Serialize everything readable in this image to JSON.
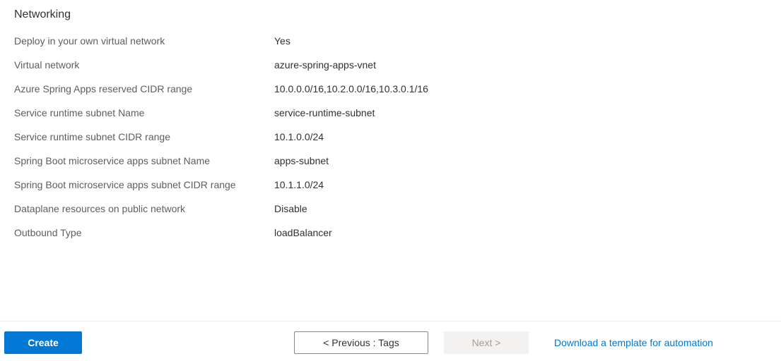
{
  "section": {
    "title": "Networking"
  },
  "fields": {
    "deployVnet": {
      "label": "Deploy in your own virtual network",
      "value": "Yes"
    },
    "vnet": {
      "label": "Virtual network",
      "value": "azure-spring-apps-vnet"
    },
    "cidrRange": {
      "label": "Azure Spring Apps reserved CIDR range",
      "value": "10.0.0.0/16,10.2.0.0/16,10.3.0.1/16"
    },
    "runtimeSubnetName": {
      "label": "Service runtime subnet Name",
      "value": "service-runtime-subnet"
    },
    "runtimeSubnetCidr": {
      "label": "Service runtime subnet CIDR range",
      "value": "10.1.0.0/24"
    },
    "appsSubnetName": {
      "label": "Spring Boot microservice apps subnet Name",
      "value": "apps-subnet"
    },
    "appsSubnetCidr": {
      "label": "Spring Boot microservice apps subnet CIDR range",
      "value": "10.1.1.0/24"
    },
    "dataplane": {
      "label": "Dataplane resources on public network",
      "value": "Disable"
    },
    "outboundType": {
      "label": "Outbound Type",
      "value": "loadBalancer"
    }
  },
  "footer": {
    "create": "Create",
    "previous": "< Previous : Tags",
    "next": "Next >",
    "download": "Download a template for automation"
  }
}
